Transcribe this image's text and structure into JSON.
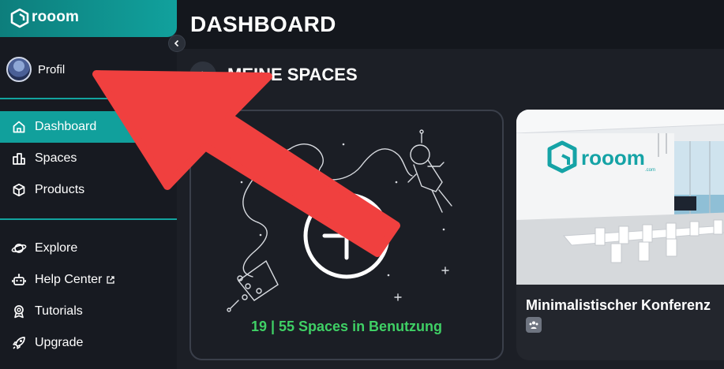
{
  "brand": {
    "name": "rooom"
  },
  "sidebar": {
    "profile_label": "Profil",
    "primary_items": [
      {
        "label": "Dashboard",
        "icon": "home-icon",
        "active": true
      },
      {
        "label": "Spaces",
        "icon": "spaces-icon",
        "active": false
      },
      {
        "label": "Products",
        "icon": "cube-icon",
        "active": false
      }
    ],
    "secondary_items": [
      {
        "label": "Explore",
        "icon": "planet-icon"
      },
      {
        "label": "Help Center",
        "icon": "robot-icon",
        "external": true
      },
      {
        "label": "Tutorials",
        "icon": "badge-icon"
      },
      {
        "label": "Upgrade",
        "icon": "rocket-icon"
      }
    ]
  },
  "header": {
    "title": "DASHBOARD"
  },
  "section": {
    "title": "MEINE SPACES"
  },
  "add_card": {
    "usage_text": "19 | 55 Spaces in Benutzung"
  },
  "space_card": {
    "title": "Minimalistischer Konferenz",
    "thumb_brand": "rooom",
    "thumb_brand_suffix": ".com"
  },
  "colors": {
    "accent": "#11a09c",
    "usage_green": "#3fd065",
    "annotation_arrow": "#f0403f"
  }
}
